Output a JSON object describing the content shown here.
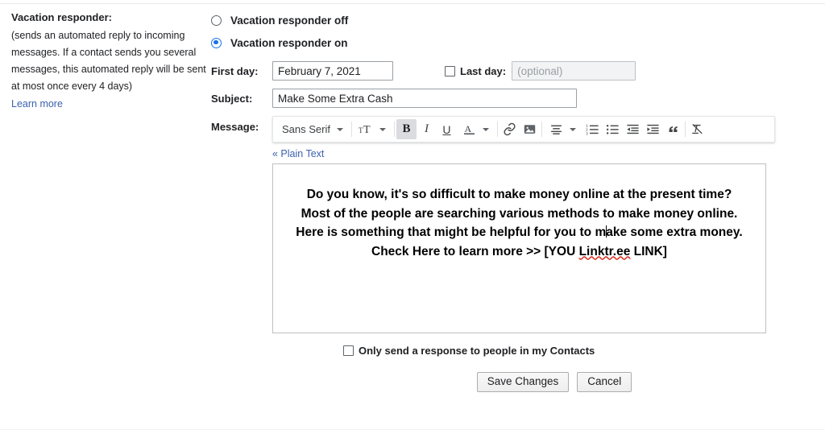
{
  "left_panel": {
    "title": "Vacation responder:",
    "note": "(sends an automated reply to incoming messages. If a contact sends you several messages, this automated reply will be sent at most once every 4 days)",
    "learn_more": "Learn more",
    "link_color": "#3c61ae"
  },
  "responder": {
    "off_label": "Vacation responder off",
    "on_label": "Vacation responder on",
    "selected": "on",
    "accent_color": "#1a73e8"
  },
  "fields": {
    "first_day_label": "First day:",
    "first_day_value": "February 7, 2021",
    "last_day_label": "Last day:",
    "last_day_checked": false,
    "last_day_placeholder": "(optional)",
    "last_day_value": "",
    "subject_label": "Subject:",
    "subject_value": "Make Some Extra Cash",
    "message_label": "Message:"
  },
  "toolbar": {
    "font_name": "Sans Serif",
    "font_size_icon": "font-size-icon",
    "bold_label": "B",
    "bold_active": true,
    "italic_label": "I",
    "underline_label": "U",
    "text_color_label": "A",
    "items": [
      "font-family-dropdown",
      "font-size-dropdown",
      "bold-button",
      "italic-button",
      "underline-button",
      "text-color-dropdown",
      "insert-link-button",
      "insert-image-button",
      "align-dropdown",
      "numbered-list-button",
      "bulleted-list-button",
      "outdent-button",
      "indent-button",
      "quote-button",
      "remove-formatting-button"
    ]
  },
  "editor": {
    "plain_text_link": "« Plain Text",
    "message_lines": [
      "Do you know, it's so difficult to make money online at the present time?",
      "Most of the people are searching various methods to make money online.",
      "Here is something that might be helpful for you to m",
      "ake some extra money.",
      "Check Here to learn more >> [YOU ",
      "Linktr.ee",
      " LINK]"
    ],
    "line3_before_cursor": "Here is something that might be helpful for you to m",
    "line3_after_cursor": "ake some extra money.",
    "line4_prefix": "Check Here to learn more >> [YOU ",
    "line4_misspelled": "Linktr.ee",
    "line4_suffix": " LINK]",
    "misspell_color": "#d93025"
  },
  "options": {
    "contacts_only_label": "Only send a response to people in my Contacts",
    "contacts_only_checked": false
  },
  "actions": {
    "save_label": "Save Changes",
    "cancel_label": "Cancel"
  }
}
